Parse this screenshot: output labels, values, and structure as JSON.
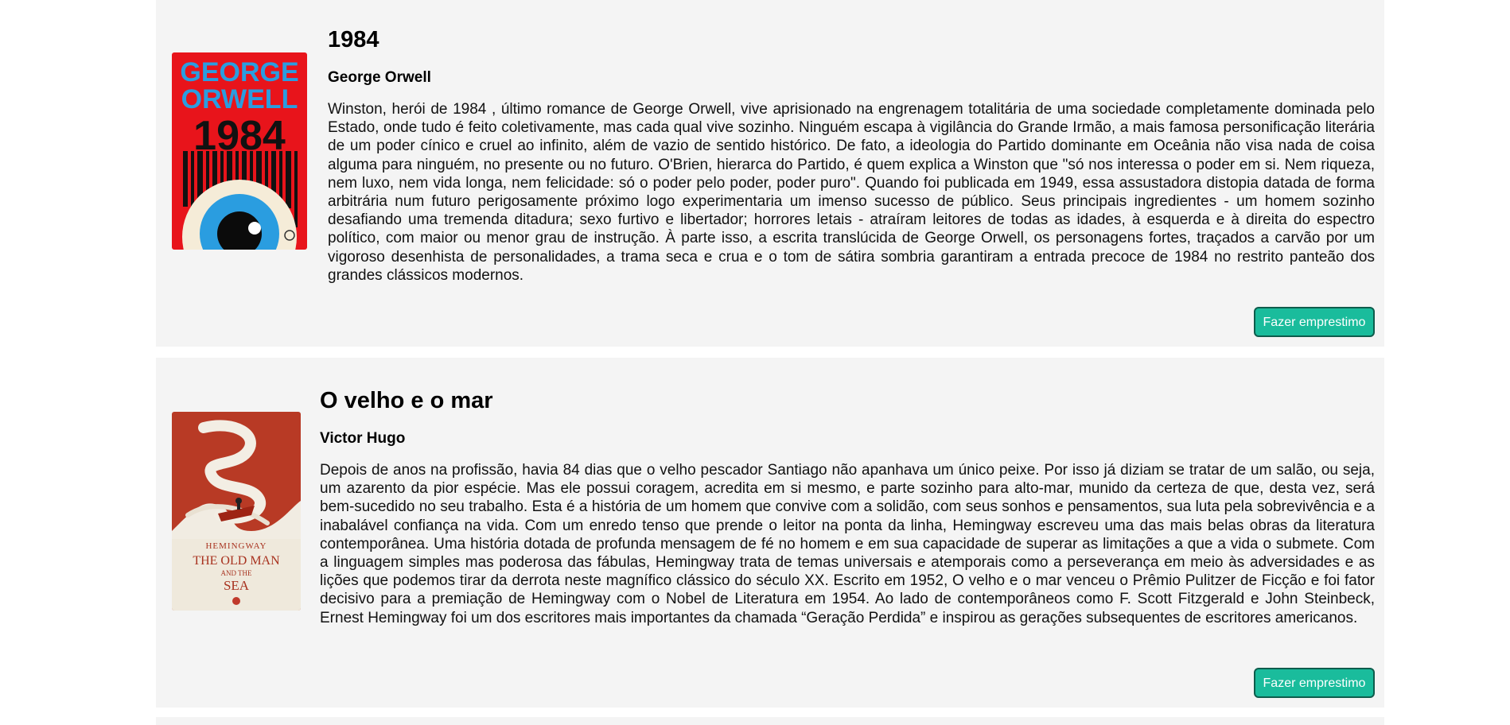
{
  "books": [
    {
      "title": "1984",
      "author": "George Orwell",
      "description": "Winston, herói de 1984 , último romance de George Orwell, vive aprisionado na engrenagem totalitária de uma sociedade completamente dominada pelo Estado, onde tudo é feito coletivamente, mas cada qual vive sozinho. Ninguém escapa à vigilância do Grande Irmão, a mais famosa personificação literária de um poder cínico e cruel ao infinito, além de vazio de sentido histórico. De fato, a ideologia do Partido dominante em Oceânia não visa nada de coisa alguma para ninguém, no presente ou no futuro. O'Brien, hierarca do Partido, é quem explica a Winston que \"só nos interessa o poder em si. Nem riqueza, nem luxo, nem vida longa, nem felicidade: só o poder pelo poder, poder puro\". Quando foi publicada em 1949, essa assustadora distopia datada de forma arbitrária num futuro perigosamente próximo logo experimentaria um imenso sucesso de público. Seus principais ingredientes - um homem sozinho desafiando uma tremenda ditadura; sexo furtivo e libertador; horrores letais - atraíram leitores de todas as idades, à esquerda e à direita do espectro político, com maior ou menor grau de instrução. À parte isso, a escrita translúcida de George Orwell, os personagens fortes, traçados a carvão por um vigoroso desenhista de personalidades, a trama seca e crua e o tom de sátira sombria garantiram a entrada precoce de 1984 no restrito panteão dos grandes clássicos modernos.",
      "button_label": "Fazer emprestimo",
      "cover": {
        "author_line1": "GEORGE",
        "author_line2": "ORWELL",
        "title": "1984",
        "background": "#e8141b",
        "accent": "#2a9de0"
      }
    },
    {
      "title": "O velho e o mar",
      "author": "Victor Hugo",
      "description": "Depois de anos na profissão, havia 84 dias que o velho pescador Santiago não apanhava um único peixe. Por isso já diziam se tratar de um salão, ou seja, um azarento da pior espécie. Mas ele possui coragem, acredita em si mesmo, e parte sozinho para alto-mar, munido da certeza de que, desta vez, será bem-sucedido no seu trabalho. Esta é a história de um homem que convive com a solidão, com seus sonhos e pensamentos, sua luta pela sobrevivência e a inabalável confiança na vida. Com um enredo tenso que prende o leitor na ponta da linha, Hemingway escreveu uma das mais belas obras da literatura contemporânea. Uma história dotada de profunda mensagem de fé no homem e em sua capacidade de superar as limitações a que a vida o submete. Com a linguagem simples mas poderosa das fábulas, Hemingway trata de temas universais e atemporais como a perseverança em meio às adversidades e as lições que podemos tirar da derrota neste magnífico clássico do século XX. Escrito em 1952, O velho e o mar venceu o Prêmio Pulitzer de Ficção e foi fator decisivo para a premiação de Hemingway com o Nobel de Literatura em 1954. Ao lado de contemporâneos como F. Scott Fitzgerald e John Steinbeck, Ernest Hemingway foi um dos escritores mais importantes da chamada “Geração Perdida” e inspirou as gerações subsequentes de escritores americanos.",
      "button_label": "Fazer emprestimo",
      "cover": {
        "author": "HEMINGWAY",
        "title_line1": "THE OLD MAN",
        "title_line2": "AND THE",
        "title_line3": "SEA",
        "background": "#b83a25",
        "accent": "#efe9dc"
      }
    }
  ]
}
